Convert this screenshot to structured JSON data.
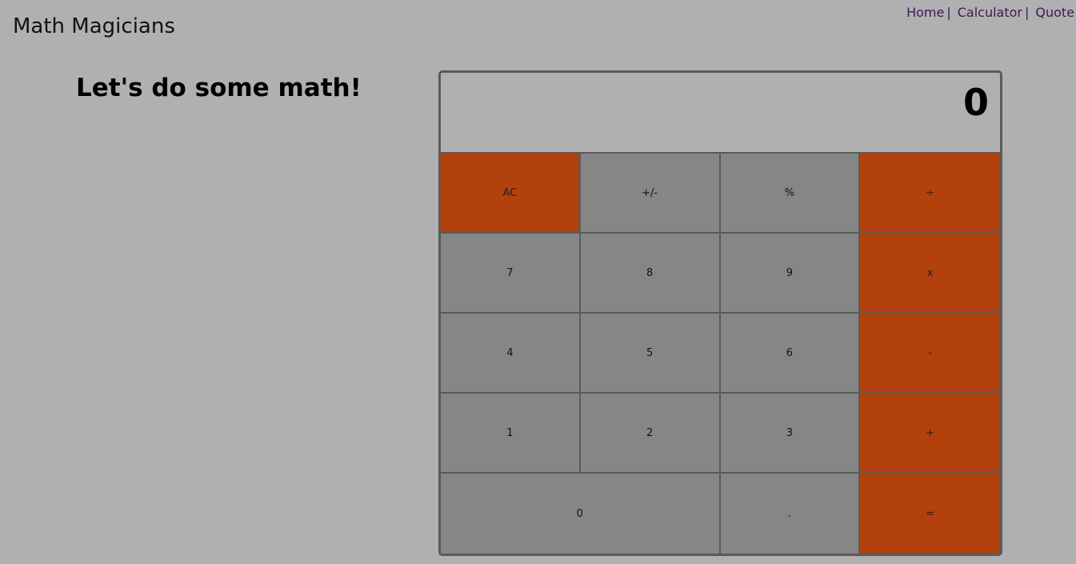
{
  "header": {
    "brand": "Math Magicians",
    "nav": [
      {
        "label": "Home"
      },
      {
        "label": "Calculator"
      },
      {
        "label": "Quote"
      }
    ],
    "separator": "|"
  },
  "main": {
    "heading": "Let's do some math!"
  },
  "calculator": {
    "display": "0",
    "keys": {
      "ac": "AC",
      "sign": "+/-",
      "percent": "%",
      "divide": "÷",
      "seven": "7",
      "eight": "8",
      "nine": "9",
      "multiply": "x",
      "four": "4",
      "five": "5",
      "six": "6",
      "subtract": "-",
      "one": "1",
      "two": "2",
      "three": "3",
      "add": "+",
      "zero": "0",
      "decimal": ".",
      "equals": "="
    }
  },
  "colors": {
    "background": "#b0b0b0",
    "key_gray": "#868686",
    "key_orange": "#b3410d",
    "nav_link": "#3b1a5a",
    "border": "#5a5a5a"
  }
}
